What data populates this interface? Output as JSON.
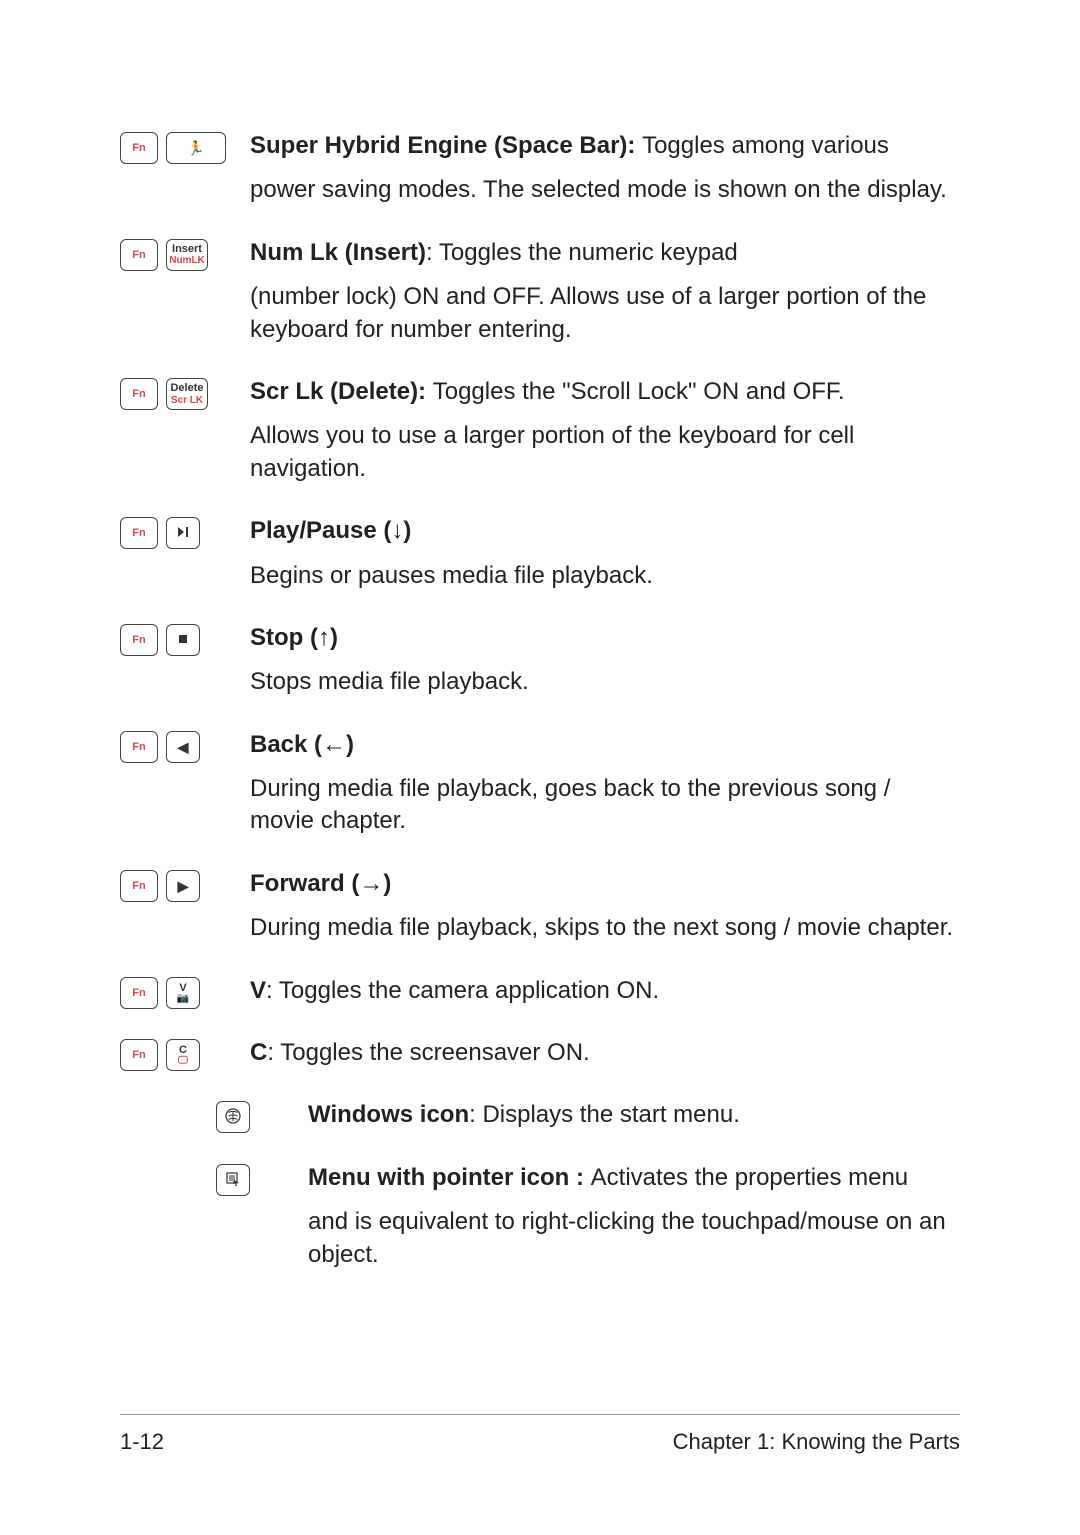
{
  "keys": {
    "fn": "Fn",
    "insert_top": "Insert",
    "insert_bot": "NumLK",
    "delete_top": "Delete",
    "delete_bot": "Scr LK",
    "v_top": "V",
    "c_top": "C"
  },
  "entries": {
    "space": {
      "title": "Super Hybrid Engine (Space Bar): ",
      "lead": "Toggles among various",
      "p2": "power saving modes. The selected mode is shown on the display."
    },
    "numlk": {
      "title": "Num Lk (Insert)",
      "lead": ": Toggles the numeric keypad",
      "p2": "(number lock) ON and OFF. Allows use of a larger portion of the keyboard for number entering."
    },
    "scrlk": {
      "title": "Scr Lk (Delete): ",
      "lead": "Toggles the \"Scroll Lock\" ON and OFF.",
      "p2": "Allows you to use a larger portion of the keyboard for cell navigation."
    },
    "play": {
      "title": "Play/Pause (↓)",
      "p2": "Begins or pauses media file playback."
    },
    "stop": {
      "title": "Stop (↑)",
      "p2": "Stops media file playback."
    },
    "back": {
      "title": "Back (←)",
      "p2": "During media file playback, goes back to the previous song / movie chapter."
    },
    "fwd": {
      "title": "Forward (→)",
      "p2": "During media file playback, skips to the next song / movie chapter."
    },
    "v": {
      "title": "V",
      "lead": ": Toggles the camera application ON."
    },
    "c": {
      "title": "C",
      "lead": ": Toggles the screensaver ON."
    },
    "win": {
      "title": "Windows icon",
      "lead": ": Displays the start menu."
    },
    "menu": {
      "title": "Menu with pointer icon : ",
      "lead": "Activates the properties menu",
      "p2": "and is equivalent to right-clicking the touchpad/mouse on an object."
    }
  },
  "footer": {
    "page": "1-12",
    "chapter": "Chapter 1:  Knowing the Parts"
  }
}
